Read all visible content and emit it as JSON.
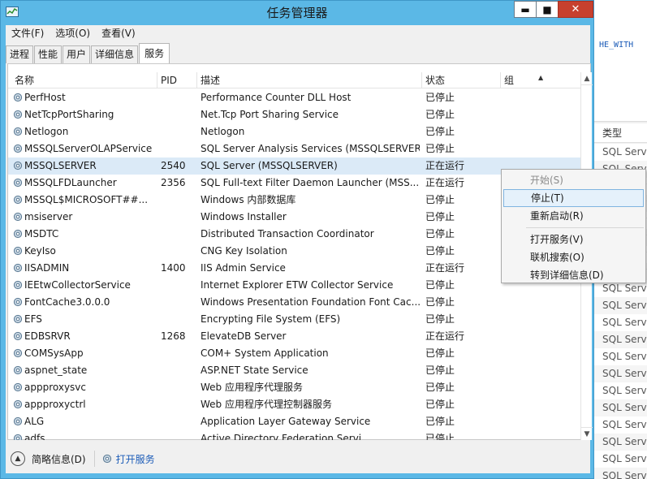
{
  "window": {
    "title": "任务管理器",
    "controls": {
      "minimize": "▬",
      "maximize": "■",
      "close": "✕"
    }
  },
  "menu": [
    "文件(F)",
    "选项(O)",
    "查看(V)"
  ],
  "tabs": [
    {
      "label": "进程",
      "active": false
    },
    {
      "label": "性能",
      "active": false
    },
    {
      "label": "用户",
      "active": false
    },
    {
      "label": "详细信息",
      "active": false
    },
    {
      "label": "服务",
      "active": true
    }
  ],
  "columns": {
    "name": "名称",
    "pid": "PID",
    "desc": "描述",
    "status": "状态",
    "group": "组"
  },
  "services": [
    {
      "name": "PerfHost",
      "pid": "",
      "desc": "Performance Counter DLL Host",
      "status": "已停止"
    },
    {
      "name": "NetTcpPortSharing",
      "pid": "",
      "desc": "Net.Tcp Port Sharing Service",
      "status": "已停止"
    },
    {
      "name": "Netlogon",
      "pid": "",
      "desc": "Netlogon",
      "status": "已停止"
    },
    {
      "name": "MSSQLServerOLAPService",
      "pid": "",
      "desc": "SQL Server Analysis Services (MSSQLSERVER)",
      "status": "已停止"
    },
    {
      "name": "MSSQLSERVER",
      "pid": "2540",
      "desc": "SQL Server (MSSQLSERVER)",
      "status": "正在运行",
      "selected": true
    },
    {
      "name": "MSSQLFDLauncher",
      "pid": "2356",
      "desc": "SQL Full-text Filter Daemon Launcher (MSS...",
      "status": "正在运行"
    },
    {
      "name": "MSSQL$MICROSOFT##...",
      "pid": "",
      "desc": "Windows 内部数据库",
      "status": "已停止"
    },
    {
      "name": "msiserver",
      "pid": "",
      "desc": "Windows Installer",
      "status": "已停止"
    },
    {
      "name": "MSDTC",
      "pid": "",
      "desc": "Distributed Transaction Coordinator",
      "status": "已停止"
    },
    {
      "name": "KeyIso",
      "pid": "",
      "desc": "CNG Key Isolation",
      "status": "已停止"
    },
    {
      "name": "IISADMIN",
      "pid": "1400",
      "desc": "IIS Admin Service",
      "status": "正在运行"
    },
    {
      "name": "IEEtwCollectorService",
      "pid": "",
      "desc": "Internet Explorer ETW Collector Service",
      "status": "已停止"
    },
    {
      "name": "FontCache3.0.0.0",
      "pid": "",
      "desc": "Windows Presentation Foundation Font Cac...",
      "status": "已停止"
    },
    {
      "name": "EFS",
      "pid": "",
      "desc": "Encrypting File System (EFS)",
      "status": "已停止"
    },
    {
      "name": "EDBSRVR",
      "pid": "1268",
      "desc": "ElevateDB Server",
      "status": "正在运行"
    },
    {
      "name": "COMSysApp",
      "pid": "",
      "desc": "COM+ System Application",
      "status": "已停止"
    },
    {
      "name": "aspnet_state",
      "pid": "",
      "desc": "ASP.NET State Service",
      "status": "已停止"
    },
    {
      "name": "appproxysvc",
      "pid": "",
      "desc": "Web 应用程序代理服务",
      "status": "已停止"
    },
    {
      "name": "appproxyctrl",
      "pid": "",
      "desc": "Web 应用程序代理控制器服务",
      "status": "已停止"
    },
    {
      "name": "ALG",
      "pid": "",
      "desc": "Application Layer Gateway Service",
      "status": "已停止"
    },
    {
      "name": "adfs...",
      "pid": "",
      "desc": "Active Directory Federation Servi...",
      "status": "已停止"
    }
  ],
  "context_menu": [
    {
      "label": "开始(S)",
      "disabled": true
    },
    {
      "label": "停止(T)",
      "hover": true
    },
    {
      "label": "重新启动(R)"
    },
    {
      "sep": true
    },
    {
      "label": "打开服务(V)"
    },
    {
      "label": "联机搜索(O)"
    },
    {
      "label": "转到详细信息(D)"
    }
  ],
  "footer": {
    "fewer_details": "简略信息(D)",
    "open_services": "打开服务"
  },
  "background_window": {
    "code_text": "HE_WITH",
    "column_header": "类型",
    "row_text": "SQL Server",
    "row_count": 21
  }
}
